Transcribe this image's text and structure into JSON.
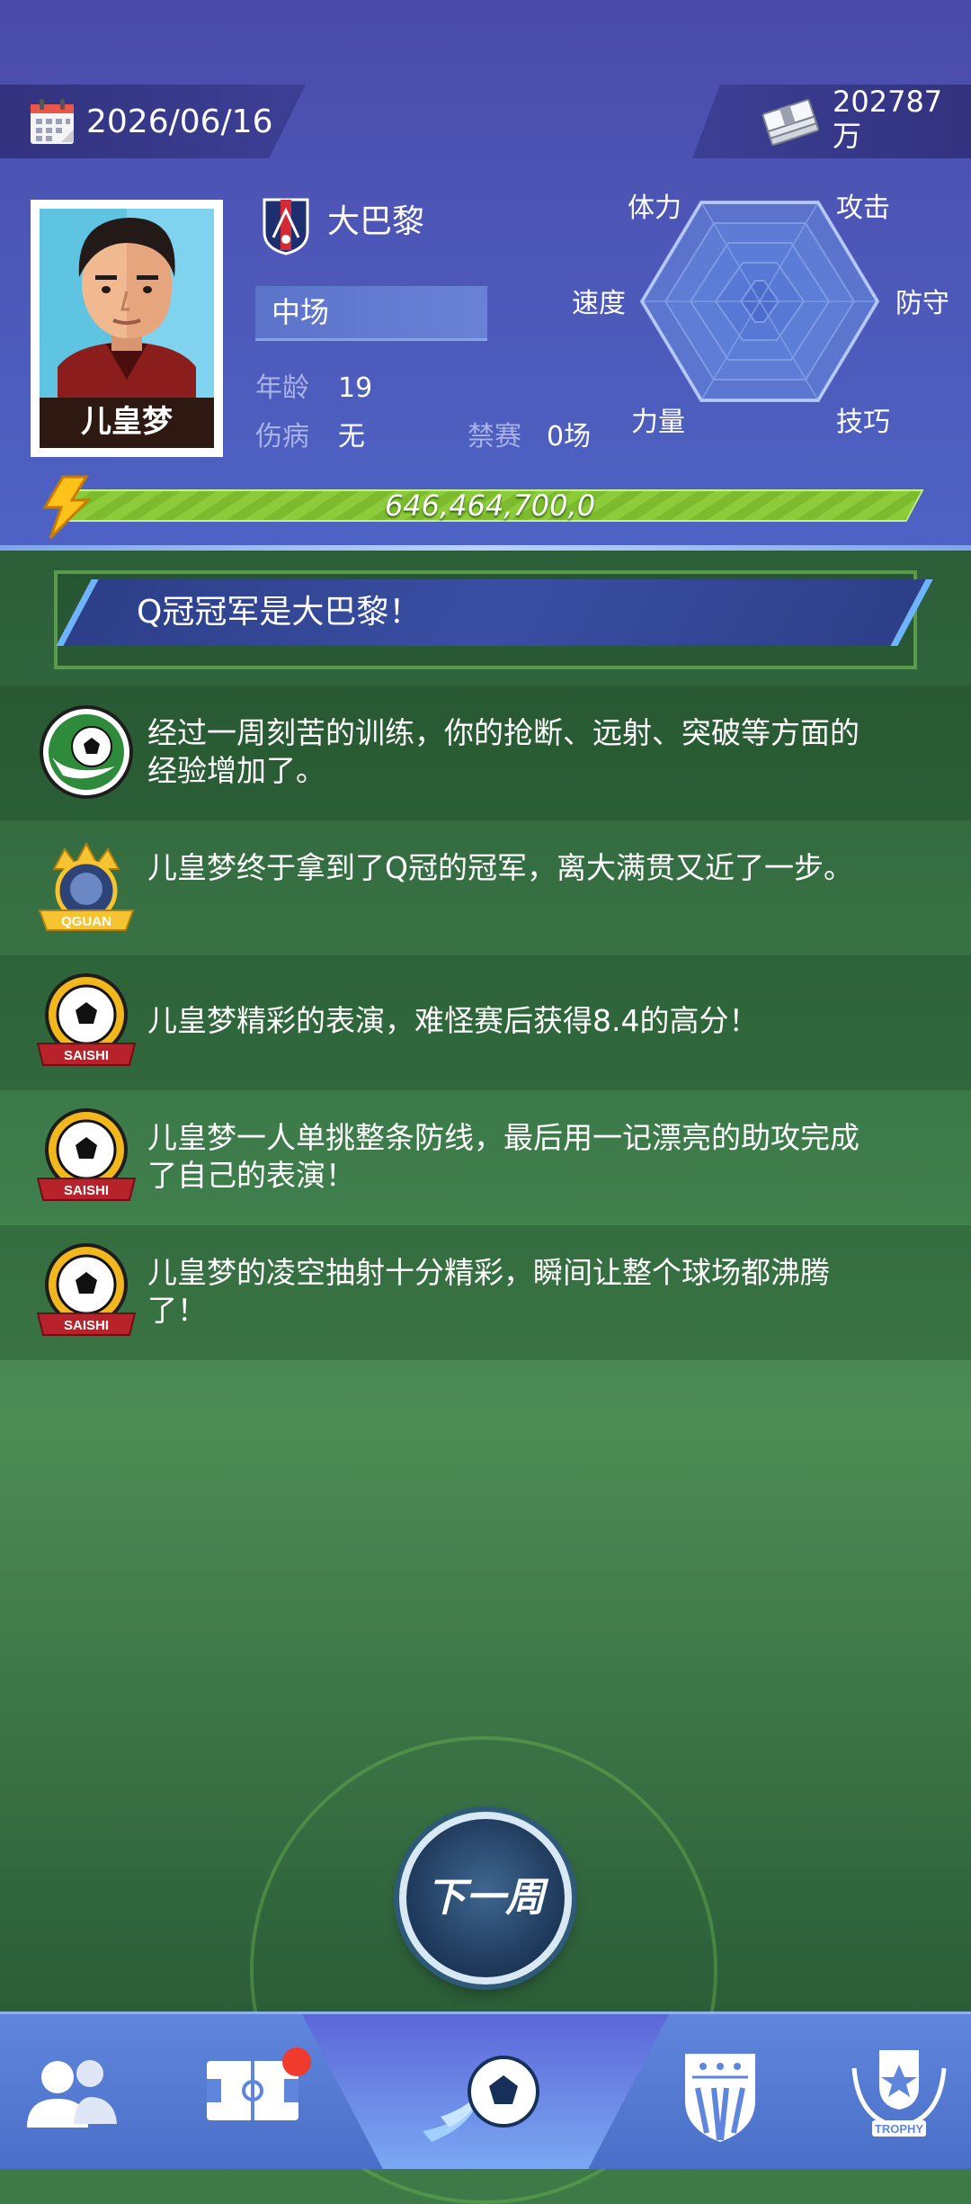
{
  "header": {
    "date": "2026/06/16",
    "money": "202787",
    "money_unit": "万",
    "player_name": "儿皇梦",
    "club": "大巴黎",
    "position": "中场",
    "age_label": "年龄",
    "age_value": "19",
    "injury_label": "伤病",
    "injury_value": "无",
    "ban_label": "禁赛",
    "ban_value": "0场",
    "energy_value": "646,464,700,0"
  },
  "radar": {
    "labels": {
      "stamina": "体力",
      "attack": "攻击",
      "speed": "速度",
      "defense": "防守",
      "power": "力量",
      "skill": "技巧"
    }
  },
  "banner": {
    "text": "Q冠冠军是大巴黎！"
  },
  "feed": [
    {
      "icon": "training-ball-icon",
      "text": "经过一周刻苦的训练，你的抢断、远射、突破等方面的经验增加了。"
    },
    {
      "icon": "qguan-trophy-icon",
      "badge": "QGUAN",
      "text": "儿皇梦终于拿到了Q冠的冠军，离大满贯又近了一步。"
    },
    {
      "icon": "match-ball-icon",
      "badge": "SAISHI",
      "text": "儿皇梦精彩的表演，难怪赛后获得8.4的高分！"
    },
    {
      "icon": "match-ball-icon",
      "badge": "SAISHI",
      "text": "儿皇梦一人单挑整条防线，最后用一记漂亮的助攻完成了自己的表演！"
    },
    {
      "icon": "match-ball-icon",
      "badge": "SAISHI",
      "text": "儿皇梦的凌空抽射十分精彩，瞬间让整个球场都沸腾了！"
    }
  ],
  "next_week_label": "下一周",
  "nav": {
    "items": [
      {
        "name": "players-icon"
      },
      {
        "name": "tactics-board-icon",
        "has_notification": true
      },
      {
        "name": "match-ball-icon",
        "active": true
      },
      {
        "name": "club-shield-icon"
      },
      {
        "name": "trophy-icon",
        "text": "TROPHY"
      }
    ]
  },
  "colors": {
    "header_bg": "#4d56b6",
    "field_green": "#3f7f4c",
    "energy_bar": "#8ccc3a",
    "nav_bg": "#5f86dc",
    "notification": "#f03a2e"
  }
}
